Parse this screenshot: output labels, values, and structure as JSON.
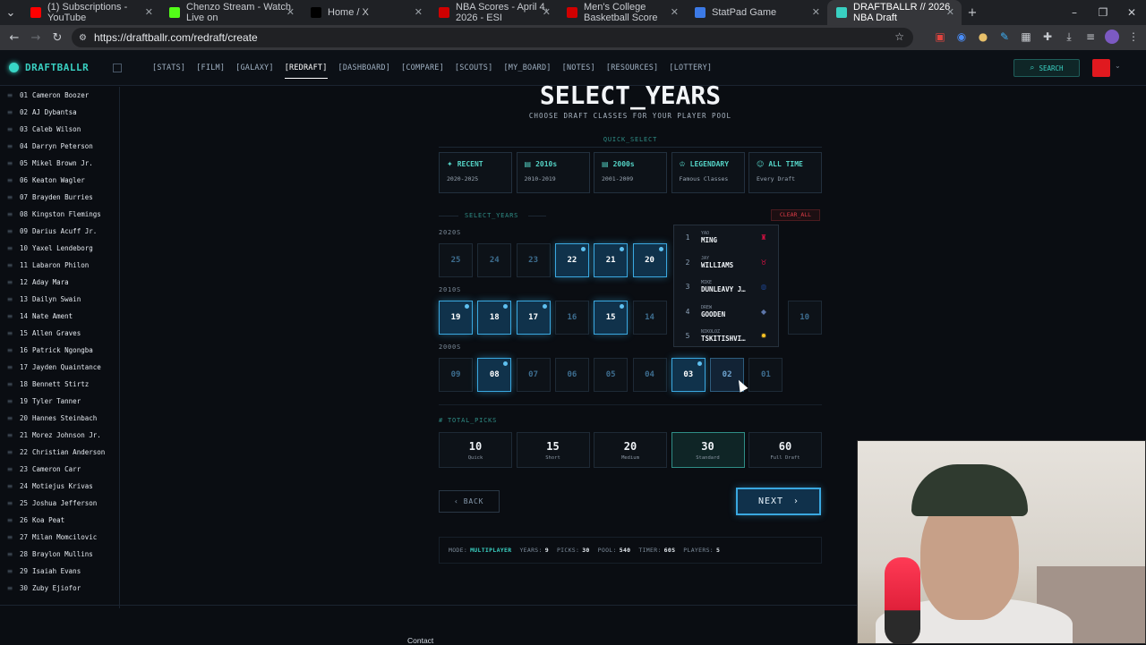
{
  "browser": {
    "tabs": [
      {
        "title": "(1) Subscriptions - YouTube",
        "color": "#ff0000"
      },
      {
        "title": "Chenzo Stream - Watch Live on",
        "color": "#53fc18"
      },
      {
        "title": "Home / X",
        "color": "#000000"
      },
      {
        "title": "NBA Scores - April 4, 2026 - ESI",
        "color": "#d00000"
      },
      {
        "title": "Men's College Basketball Score",
        "color": "#d00000"
      },
      {
        "title": "StatPad Game",
        "color": "#3c7ae6"
      },
      {
        "title": "DRAFTBALLR // 2026 NBA Draft",
        "color": "#39d0c2"
      }
    ],
    "url": "https://draftballr.com/redraft/create"
  },
  "header": {
    "logo": "DRAFTBALLR",
    "nav": [
      "[STATS]",
      "[FILM]",
      "[GALAXY]",
      "[REDRAFT]",
      "[DASHBOARD]",
      "[COMPARE]",
      "[SCOUTS]",
      "[MY_BOARD]",
      "[NOTES]",
      "[RESOURCES]",
      "[LOTTERY]"
    ],
    "active_nav": "[REDRAFT]",
    "search_label": "SEARCH"
  },
  "sidebar": {
    "items": [
      {
        "num": "01",
        "name": "Cameron Boozer"
      },
      {
        "num": "02",
        "name": "AJ Dybantsa"
      },
      {
        "num": "03",
        "name": "Caleb Wilson"
      },
      {
        "num": "04",
        "name": "Darryn Peterson"
      },
      {
        "num": "05",
        "name": "Mikel Brown Jr."
      },
      {
        "num": "06",
        "name": "Keaton Wagler"
      },
      {
        "num": "07",
        "name": "Brayden Burries"
      },
      {
        "num": "08",
        "name": "Kingston Flemings"
      },
      {
        "num": "09",
        "name": "Darius Acuff Jr."
      },
      {
        "num": "10",
        "name": "Yaxel Lendeborg"
      },
      {
        "num": "11",
        "name": "Labaron Philon"
      },
      {
        "num": "12",
        "name": "Aday Mara"
      },
      {
        "num": "13",
        "name": "Dailyn Swain"
      },
      {
        "num": "14",
        "name": "Nate Ament"
      },
      {
        "num": "15",
        "name": "Allen Graves"
      },
      {
        "num": "16",
        "name": "Patrick Ngongba"
      },
      {
        "num": "17",
        "name": "Jayden Quaintance"
      },
      {
        "num": "18",
        "name": "Bennett Stirtz"
      },
      {
        "num": "19",
        "name": "Tyler Tanner"
      },
      {
        "num": "20",
        "name": "Hannes Steinbach"
      },
      {
        "num": "21",
        "name": "Morez Johnson Jr."
      },
      {
        "num": "22",
        "name": "Christian Anderson"
      },
      {
        "num": "23",
        "name": "Cameron Carr"
      },
      {
        "num": "24",
        "name": "Motiejus Krivas"
      },
      {
        "num": "25",
        "name": "Joshua Jefferson"
      },
      {
        "num": "26",
        "name": "Koa Peat"
      },
      {
        "num": "27",
        "name": "Milan Momcilovic"
      },
      {
        "num": "28",
        "name": "Braylon Mullins"
      },
      {
        "num": "29",
        "name": "Isaiah Evans"
      },
      {
        "num": "30",
        "name": "Zuby Ejiofor"
      }
    ]
  },
  "main": {
    "title": "SELECT_YEARS",
    "subtitle": "CHOOSE DRAFT CLASSES FOR YOUR PLAYER POOL",
    "quick_select_label": "QUICK_SELECT",
    "quick_select": [
      {
        "title": "RECENT",
        "desc": "2020-2025",
        "icon": "sparkle-icon"
      },
      {
        "title": "2010s",
        "desc": "2010-2019",
        "icon": "calendar-icon"
      },
      {
        "title": "2000s",
        "desc": "2001-2009",
        "icon": "calendar-icon"
      },
      {
        "title": "LEGENDARY",
        "desc": "Famous Classes",
        "icon": "trophy-icon"
      },
      {
        "title": "ALL TIME",
        "desc": "Every Draft",
        "icon": "users-icon"
      }
    ],
    "select_years_label": "SELECT_YEARS",
    "clear_all": "CLEAR_ALL",
    "decades": [
      {
        "label": "2020S",
        "years": [
          {
            "y": "25",
            "sel": false
          },
          {
            "y": "24",
            "sel": false
          },
          {
            "y": "23",
            "sel": false
          },
          {
            "y": "22",
            "sel": true
          },
          {
            "y": "21",
            "sel": true
          },
          {
            "y": "20",
            "sel": true
          }
        ]
      },
      {
        "label": "2010S",
        "years": [
          {
            "y": "19",
            "sel": true
          },
          {
            "y": "18",
            "sel": true
          },
          {
            "y": "17",
            "sel": true
          },
          {
            "y": "16",
            "sel": false
          },
          {
            "y": "15",
            "sel": true
          },
          {
            "y": "14",
            "sel": false
          },
          {
            "y": "10",
            "sel": false
          }
        ]
      },
      {
        "label": "2000S",
        "years": [
          {
            "y": "09",
            "sel": false
          },
          {
            "y": "08",
            "sel": true
          },
          {
            "y": "07",
            "sel": false
          },
          {
            "y": "06",
            "sel": false
          },
          {
            "y": "05",
            "sel": false
          },
          {
            "y": "04",
            "sel": false
          },
          {
            "y": "03",
            "sel": true
          },
          {
            "y": "02",
            "sel": false,
            "hover": true
          },
          {
            "y": "01",
            "sel": false
          }
        ]
      }
    ],
    "tooltip": [
      {
        "rank": "1",
        "first": "YAO",
        "last": "MING",
        "color": "#ce1141",
        "icon": "rockets-logo-icon"
      },
      {
        "rank": "2",
        "first": "JAY",
        "last": "WILLIAMS",
        "color": "#ce1141",
        "icon": "bulls-logo-icon"
      },
      {
        "rank": "3",
        "first": "MIKE",
        "last": "DUNLEAVY J…",
        "color": "#1d428a",
        "icon": "warriors-logo-icon"
      },
      {
        "rank": "4",
        "first": "DREW",
        "last": "GOODEN",
        "color": "#5d76a9",
        "icon": "grizzlies-logo-icon"
      },
      {
        "rank": "5",
        "first": "NIKOLOZ",
        "last": "TSKITISHVI…",
        "color": "#fec524",
        "icon": "nuggets-logo-icon"
      }
    ],
    "total_picks_label": "TOTAL_PICKS",
    "picks": [
      {
        "v": "10",
        "l": "Quick",
        "sel": false
      },
      {
        "v": "15",
        "l": "Short",
        "sel": false
      },
      {
        "v": "20",
        "l": "Medium",
        "sel": false
      },
      {
        "v": "30",
        "l": "Standard",
        "sel": true
      },
      {
        "v": "60",
        "l": "Full Draft",
        "sel": false
      }
    ],
    "back_label": "BACK",
    "next_label": "NEXT",
    "summary": {
      "mode_k": "MODE:",
      "mode_v": "MULTIPLAYER",
      "years_k": "YEARS:",
      "years_v": "9",
      "picks_k": "PICKS:",
      "picks_v": "30",
      "pool_k": "POOL:",
      "pool_v": "540",
      "timer_k": "TIMER:",
      "timer_v": "60S",
      "players_k": "PLAYERS:",
      "players_v": "5"
    }
  },
  "footer": {
    "contact": "Contact"
  }
}
